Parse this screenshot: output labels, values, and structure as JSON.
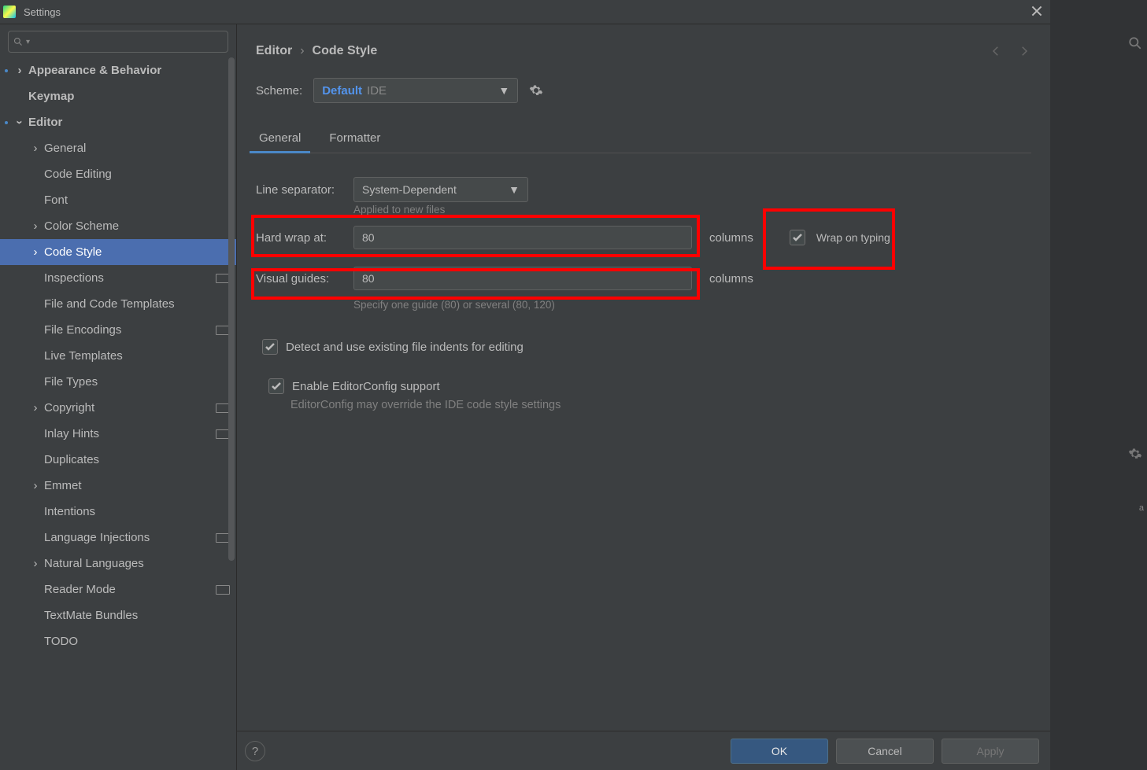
{
  "title": "Settings",
  "breadcrumb": {
    "root": "Editor",
    "leaf": "Code Style"
  },
  "scheme": {
    "label": "Scheme:",
    "name": "Default",
    "scope": "IDE"
  },
  "tabs": {
    "general": "General",
    "formatter": "Formatter"
  },
  "sidebar": {
    "appearance": "Appearance & Behavior",
    "keymap": "Keymap",
    "editor": "Editor",
    "general": "General",
    "code_editing": "Code Editing",
    "font": "Font",
    "color_scheme": "Color Scheme",
    "code_style": "Code Style",
    "inspections": "Inspections",
    "file_templates": "File and Code Templates",
    "file_encodings": "File Encodings",
    "live_templates": "Live Templates",
    "file_types": "File Types",
    "copyright": "Copyright",
    "inlay_hints": "Inlay Hints",
    "duplicates": "Duplicates",
    "emmet": "Emmet",
    "intentions": "Intentions",
    "lang_injections": "Language Injections",
    "nat_languages": "Natural Languages",
    "reader_mode": "Reader Mode",
    "textmate": "TextMate Bundles",
    "todo": "TODO"
  },
  "form": {
    "line_separator_label": "Line separator:",
    "line_separator_value": "System-Dependent",
    "line_separator_hint": "Applied to new files",
    "hard_wrap_label": "Hard wrap at:",
    "hard_wrap_value": "80",
    "columns_suffix": "columns",
    "wrap_on_typing": "Wrap on typing",
    "visual_guides_label": "Visual guides:",
    "visual_guides_value": "80",
    "visual_guides_hint": "Specify one guide (80) or several (80, 120)",
    "detect_indents": "Detect and use existing file indents for editing",
    "enable_editorconfig": "Enable EditorConfig support",
    "editorconfig_note": "EditorConfig may override the IDE code style settings"
  },
  "buttons": {
    "ok": "OK",
    "cancel": "Cancel",
    "apply": "Apply",
    "help": "?"
  },
  "gutter": {
    "label": "a"
  }
}
